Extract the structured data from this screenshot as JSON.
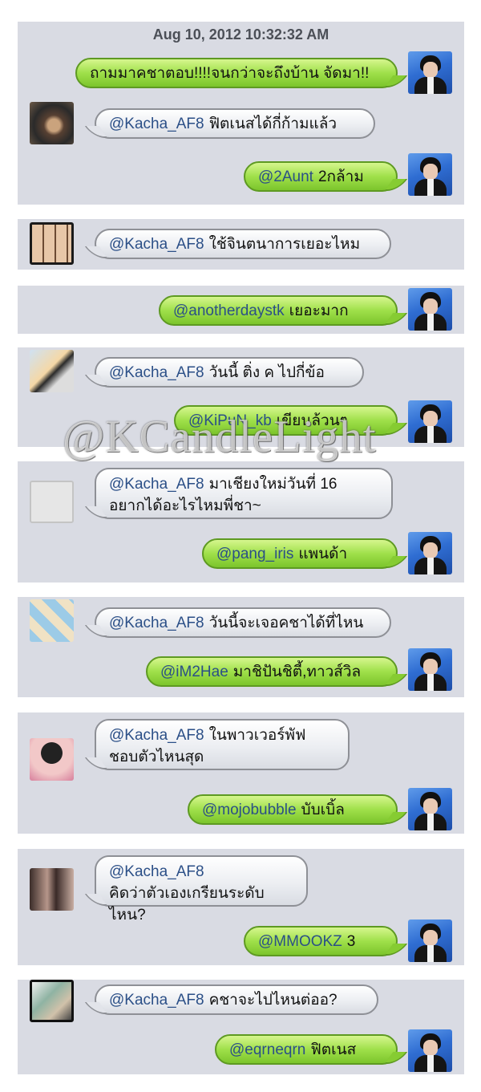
{
  "timestamp": "Aug 10, 2012 10:32:32 AM",
  "watermark": "@KCandleLight",
  "colors": {
    "panel": "#d9dbe3",
    "outgoing_bubble": "#9fe04a",
    "incoming_bubble": "#eceef2",
    "mention": "#2b4f87"
  },
  "panels": [
    {
      "messages": [
        {
          "side": "right",
          "avatar": "user-avatar",
          "mention": "",
          "text": "ถามมาคชาตอบ!!!!จนกว่าจะถึงบ้าน จัดมา!!"
        },
        {
          "side": "left",
          "avatar": "follower-avatar",
          "mention": "@Kacha_AF8",
          "text": "ฟิตเนสได้กี่ก้ามแล้ว"
        },
        {
          "side": "right",
          "avatar": "user-avatar",
          "mention": "@2Aunt",
          "text": "2กล้าม"
        }
      ]
    },
    {
      "messages": [
        {
          "side": "left",
          "avatar": "follower-avatar",
          "mention": "@Kacha_AF8",
          "text": "ใช้จินตนาการเยอะไหม"
        }
      ]
    },
    {
      "messages": [
        {
          "side": "right",
          "avatar": "user-avatar",
          "mention": "@anotherdaystk",
          "text": "เยอะมาก"
        }
      ]
    },
    {
      "messages": [
        {
          "side": "left",
          "avatar": "follower-avatar",
          "mention": "@Kacha_AF8",
          "text": "วันนี้ ติ่ง ค ไปกี่ข้อ"
        },
        {
          "side": "right",
          "avatar": "user-avatar",
          "mention": "@KiPuN_kb",
          "text": "เขียนล้วนๆ"
        }
      ]
    },
    {
      "messages": [
        {
          "side": "left",
          "avatar": "follower-avatar",
          "mention": "@Kacha_AF8",
          "text": "มาเชียงใหม่วันที่ 16",
          "text2": "อยากได้อะไรไหมพี่ชา~"
        },
        {
          "side": "right",
          "avatar": "user-avatar",
          "mention": "@pang_iris",
          "text": "แพนด้า"
        }
      ]
    },
    {
      "messages": [
        {
          "side": "left",
          "avatar": "follower-avatar",
          "mention": "@Kacha_AF8",
          "text": "วันนี้จะเจอคชาได้ที่ไหน"
        },
        {
          "side": "right",
          "avatar": "user-avatar",
          "mention": "@iM2Hae",
          "text": "มาชิปันชิตี้,ทาวส์วิล"
        }
      ]
    },
    {
      "messages": [
        {
          "side": "left",
          "avatar": "follower-avatar",
          "mention": "@Kacha_AF8",
          "text": "ในพาวเวอร์พัฟ",
          "text2": "ชอบตัวไหนสุด"
        },
        {
          "side": "right",
          "avatar": "user-avatar",
          "mention": "@mojobubble",
          "text": "บับเบิ้ล"
        }
      ]
    },
    {
      "messages": [
        {
          "side": "left",
          "avatar": "follower-avatar",
          "mention": "@Kacha_AF8",
          "text": "คิดว่าตัวเองเกรียนระดับไหน?"
        },
        {
          "side": "right",
          "avatar": "user-avatar",
          "mention": "@MMOOKZ",
          "text": "3"
        }
      ]
    },
    {
      "messages": [
        {
          "side": "left",
          "avatar": "follower-avatar",
          "mention": "@Kacha_AF8",
          "text": "คชาจะไปไหนต่ออ?"
        },
        {
          "side": "right",
          "avatar": "user-avatar",
          "mention": "@eqrneqrn",
          "text": "ฟิตเนส"
        }
      ]
    }
  ]
}
